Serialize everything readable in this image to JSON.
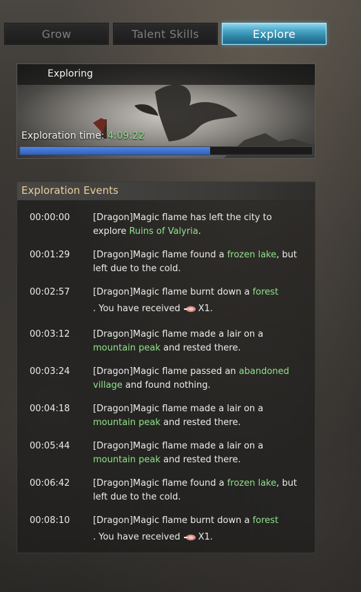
{
  "tabs": [
    {
      "label": "Grow",
      "active": false
    },
    {
      "label": "Talent Skills",
      "active": false
    },
    {
      "label": "Explore",
      "active": true
    }
  ],
  "banner": {
    "title": "Exploring",
    "time_label": "Exploration time:",
    "time_value": "4:09:22",
    "progress_fraction": 0.65
  },
  "events": {
    "title": "Exploration Events",
    "items": [
      {
        "time": "00:00:00",
        "pre": "[Dragon]Magic flame has left the city to explore ",
        "hl": "Ruins of Valyria",
        "post": "."
      },
      {
        "time": "00:01:29",
        "pre": "[Dragon]Magic flame found a ",
        "hl": "frozen lake",
        "post": ", but left due to the cold."
      },
      {
        "time": "00:02:57",
        "pre": "[Dragon]Magic flame burnt down a ",
        "hl": "forest",
        "post": ". You have received",
        "reward_qty": "X1.",
        "reward_icon": "meat-icon"
      },
      {
        "time": "00:03:12",
        "pre": "[Dragon]Magic flame made a lair on a ",
        "hl": "mountain peak",
        "post": " and rested there."
      },
      {
        "time": "00:03:24",
        "pre": "[Dragon]Magic flame passed an ",
        "hl": "abandoned village",
        "post": " and found nothing."
      },
      {
        "time": "00:04:18",
        "pre": "[Dragon]Magic flame made a lair on a ",
        "hl": "mountain peak",
        "post": " and rested there."
      },
      {
        "time": "00:05:44",
        "pre": "[Dragon]Magic flame made a lair on a ",
        "hl": "mountain peak",
        "post": " and rested there."
      },
      {
        "time": "00:06:42",
        "pre": "[Dragon]Magic flame found a ",
        "hl": "frozen lake",
        "post": ", but left due to the cold."
      },
      {
        "time": "00:08:10",
        "pre": "[Dragon]Magic flame burnt down a ",
        "hl": "forest",
        "post": ". You have received",
        "reward_qty": "X1.",
        "reward_icon": "meat-icon"
      }
    ]
  },
  "colors": {
    "highlight": "#8fe38a",
    "header_text": "#e8cf9a",
    "progress": "#3c6fd6",
    "active_tab": "#3f9fc3"
  }
}
